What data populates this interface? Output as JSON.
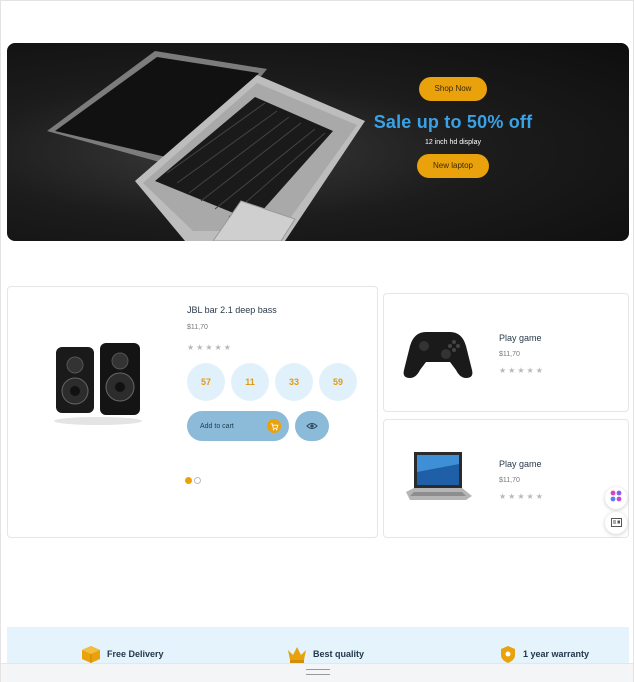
{
  "hero": {
    "shop_label": "Shop Now",
    "title": "Sale up to 50% off",
    "subtitle": "12 inch hd display",
    "new_label": "New laptop"
  },
  "featured": {
    "title": "JBL bar 2.1 deep bass",
    "price": "$11,70",
    "stars": "★★★★★",
    "countdown": [
      "57",
      "11",
      "33",
      "59"
    ],
    "add_to_cart": "Add to cart"
  },
  "side_products": [
    {
      "title": "Play game",
      "price": "$11,70",
      "stars": "★★★★★"
    },
    {
      "title": "Play game",
      "price": "$11,70",
      "stars": "★★★★★"
    }
  ],
  "features": [
    {
      "label": "Free Delivery"
    },
    {
      "label": "Best quality"
    },
    {
      "label": "1 year warranty"
    }
  ],
  "colors": {
    "accent": "#e9a20c",
    "hero_title": "#39a2e6",
    "button_blue": "#8bbbd8",
    "countdown_bg": "#e1f1fb",
    "features_bg": "#e4f3fc"
  },
  "icons": [
    "cart-icon",
    "eye-icon",
    "delivery-box-icon",
    "crown-icon",
    "warranty-shield-icon",
    "app-grid-icon",
    "reader-icon"
  ]
}
